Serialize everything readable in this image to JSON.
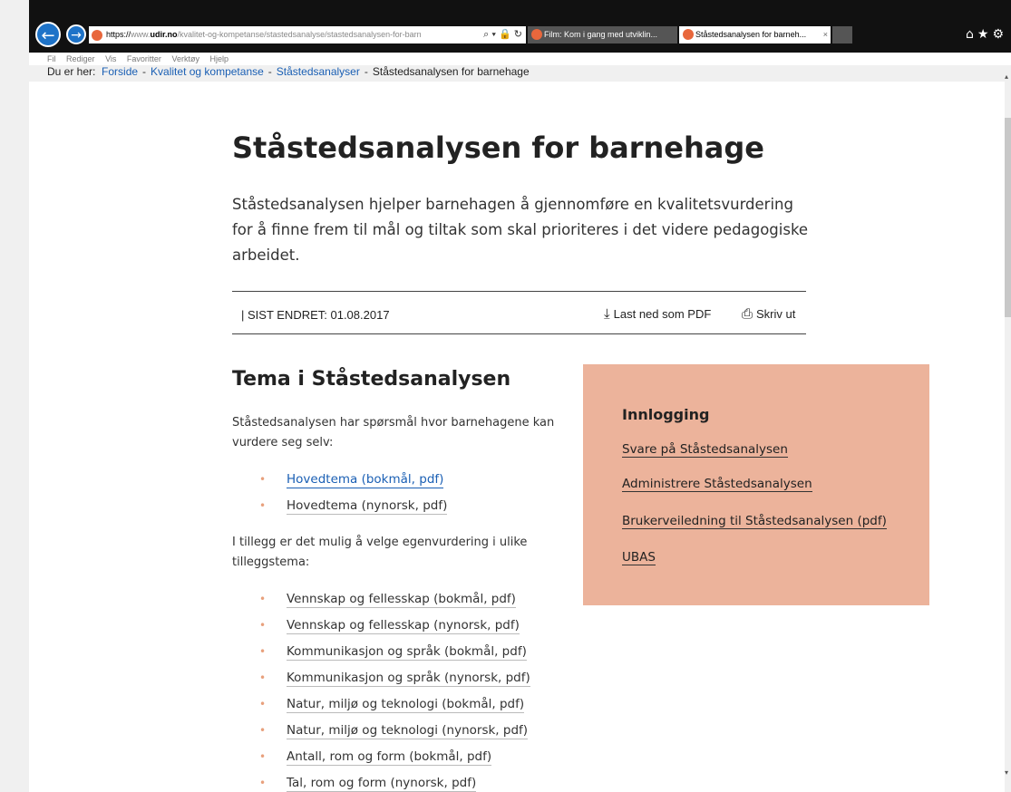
{
  "browser": {
    "url_scheme": "https://",
    "url_prefix": "www.",
    "url_host": "udir.no",
    "url_path": "/kvalitet-og-kompetanse/stastedsanalyse/stastedsanalysen-for-barn",
    "url_icons": "⌕ ▾ 🔒 ↻",
    "tabs": [
      {
        "label": "Film: Kom i gang med utviklin...",
        "active": false
      },
      {
        "label": "Ståstedsanalysen for barneh...",
        "active": true,
        "close": "×"
      }
    ],
    "menu": [
      "Fil",
      "Rediger",
      "Vis",
      "Favoritter",
      "Verktøy",
      "Hjelp"
    ]
  },
  "breadcrumb": {
    "prefix": "Du er her:",
    "items": [
      "Forside",
      "Kvalitet og kompetanse",
      "Ståstedsanalyser"
    ],
    "current": "Ståstedsanalysen for barnehage",
    "separator": "-"
  },
  "page": {
    "title": "Ståstedsanalysen for barnehage",
    "intro": "Ståstedsanalysen hjelper barnehagen å gjennomføre en kvalitetsvurdering for å finne frem til mål og tiltak som skal prioriteres i det videre pedagogiske arbeidet.",
    "last_changed": "|   SIST ENDRET: 01.08.2017",
    "download_pdf": "Last ned som PDF",
    "print": "Skriv ut"
  },
  "section": {
    "heading": "Tema i Ståstedsanalysen",
    "para1": "Ståstedsanalysen har spørsmål hvor barnehagene kan vurdere seg selv:",
    "main_topics": [
      "Hovedtema (bokmål, pdf)",
      "Hovedtema (nynorsk, pdf)"
    ],
    "para2": "I tillegg er det mulig å velge egenvurdering i ulike tilleggstema:",
    "extra_topics": [
      "Vennskap og fellesskap (bokmål, pdf)",
      "Vennskap og fellesskap (nynorsk, pdf)",
      "Kommunikasjon og språk (bokmål, pdf)",
      "Kommunikasjon og språk (nynorsk, pdf)",
      "Natur, miljø og teknologi (bokmål, pdf)",
      "Natur, miljø og teknologi (nynorsk, pdf)",
      "Antall, rom og form (bokmål, pdf)",
      "Tal, rom og form (nynorsk, pdf)"
    ]
  },
  "login_panel": {
    "heading": "Innlogging",
    "links": [
      "Svare på Ståstedsanalysen",
      "Administrere Ståstedsanalysen",
      "Brukerveiledning til Ståstedsanalysen (pdf)",
      "UBAS"
    ]
  },
  "colors": {
    "accent": "#1a5fb4",
    "panel": "#ecb39b",
    "bullet": "#e8a07c"
  }
}
